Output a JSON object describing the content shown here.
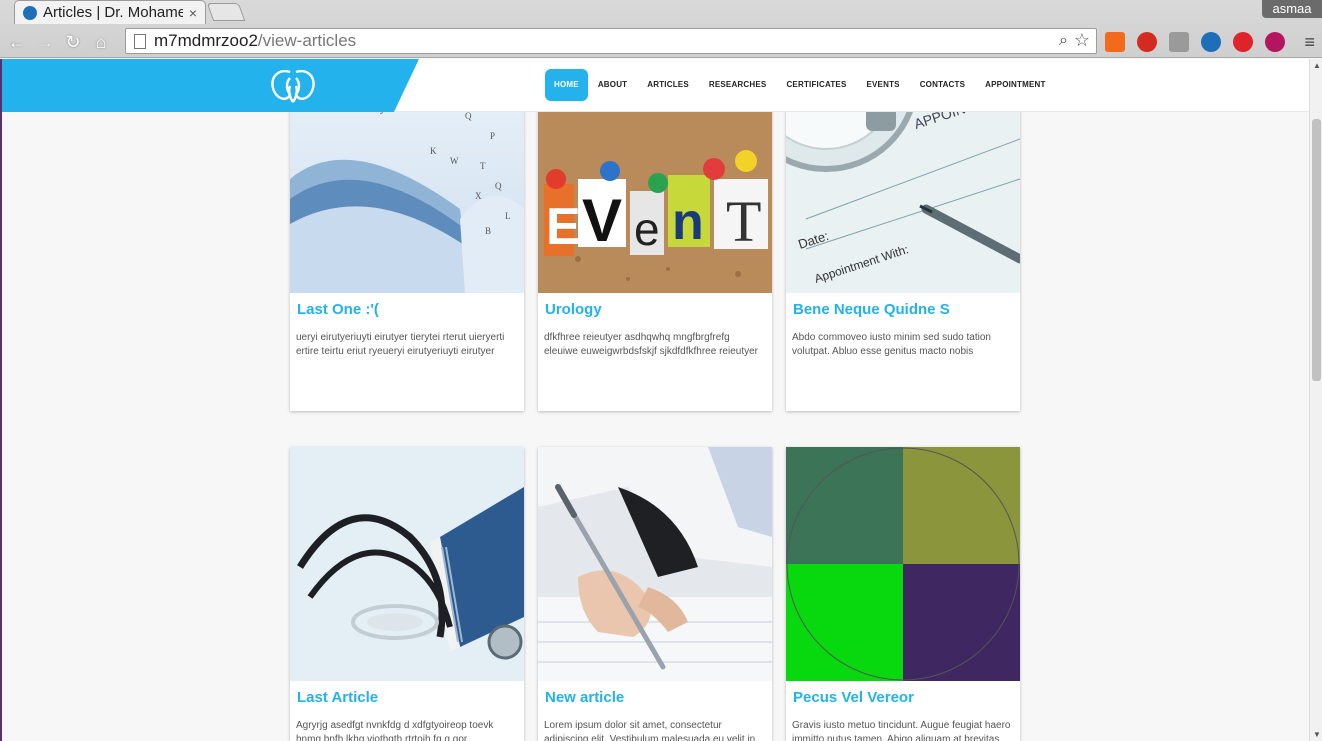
{
  "browser": {
    "tab_title": "Articles | Dr. Mohamed",
    "tab_close": "×",
    "user": "asmaa",
    "url_host": "m7mdmrzoo2",
    "url_path": "/view-articles"
  },
  "nav": {
    "items": [
      "HOME",
      "ABOUT",
      "ARTICLES",
      "RESEARCHES",
      "CERTIFICATES",
      "EVENTS",
      "CONTACTS",
      "APPOINTMENT"
    ]
  },
  "cards": [
    {
      "title": "Last One :'(",
      "desc": "ueryi eirutyeriuyti eirutyer tierytei rterut uieryerti ertire teirtu eriut ryeueryi eirutyeriuyti eirutyer",
      "image": "open-book-icon"
    },
    {
      "title": "Urology",
      "desc": "dfkfhree reieutyer asdhqwhq mngfbrgfrefg eleuiwe euweigwrbdsfskjf sjkdfdfkfhree reieutyer",
      "image": "event-corkboard-icon"
    },
    {
      "title": "Bene Neque Quidne S",
      "desc": "Abdo commoveo iusto minim sed sudo tation volutpat. Abluo esse genitus macto nobis",
      "image": "appointment-watch-icon"
    },
    {
      "title": "Last Article",
      "desc": "Agryrjg asedfgt nvnkfdg d xdfgtyoireop toevk hnmg bnfh lkhg viothgth rtrtoih fg g gor",
      "image": "stethoscope-icon"
    },
    {
      "title": "New article",
      "desc": "Lorem ipsum dolor sit amet, consectetur adipiscing elit. Vestibulum malesuada eu velit in venenatis",
      "image": "doctor-writing-icon"
    },
    {
      "title": "Pecus Vel Vereor",
      "desc": "Gravis iusto metuo tincidunt. Augue feugiat haero immitto nutus tamen. Abigo aliquam at brevitas",
      "image": "placeholder-quadrant-icon"
    }
  ],
  "colors": {
    "accent": "#23b2ec"
  }
}
